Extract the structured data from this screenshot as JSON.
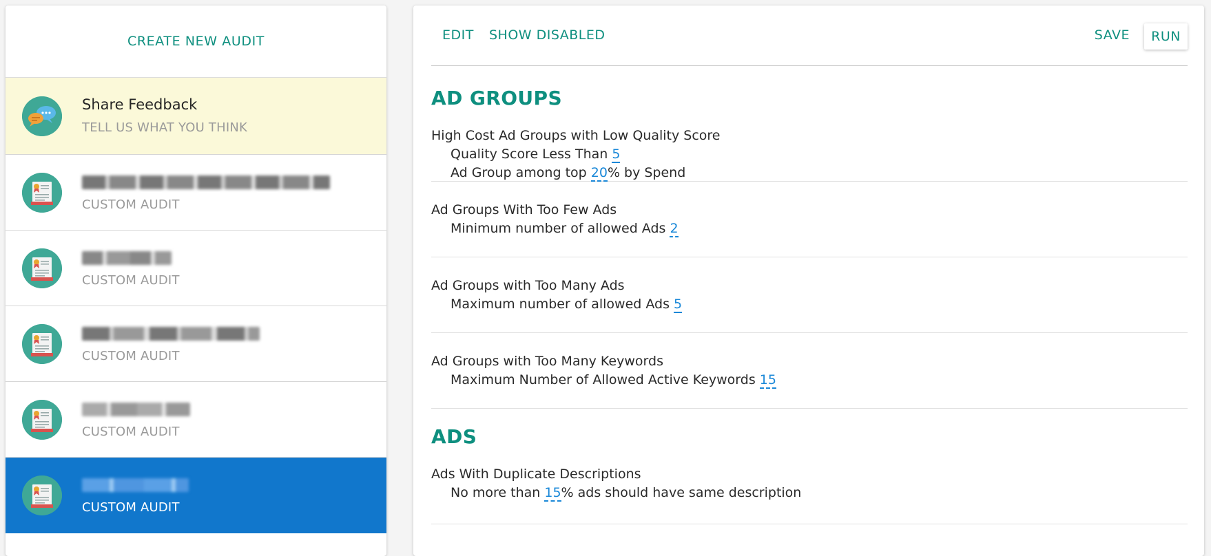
{
  "sidebar": {
    "create_label": "CREATE NEW AUDIT",
    "feedback": {
      "title": "Share Feedback",
      "subtitle": "TELL US WHAT YOU THINK"
    },
    "audits": [
      {
        "subtitle": "CUSTOM AUDIT",
        "selected": false
      },
      {
        "subtitle": "CUSTOM AUDIT",
        "selected": false
      },
      {
        "subtitle": "CUSTOM AUDIT",
        "selected": false
      },
      {
        "subtitle": "CUSTOM AUDIT",
        "selected": false
      },
      {
        "subtitle": "CUSTOM AUDIT",
        "selected": true
      }
    ]
  },
  "toolbar": {
    "edit_label": "EDIT",
    "show_disabled_label": "SHOW DISABLED",
    "save_label": "SAVE",
    "run_label": "RUN"
  },
  "sections": [
    {
      "title": "AD GROUPS",
      "rules": [
        {
          "name": "High Cost Ad Groups with Low Quality Score",
          "params": [
            {
              "before": "Quality Score Less Than ",
              "value": "5",
              "after": ""
            },
            {
              "before": "Ad Group among top ",
              "value": "20",
              "after": "% by Spend"
            }
          ]
        },
        {
          "name": "Ad Groups With Too Few Ads",
          "params": [
            {
              "before": "Minimum number of allowed Ads ",
              "value": "2",
              "after": ""
            }
          ]
        },
        {
          "name": "Ad Groups with Too Many Ads",
          "params": [
            {
              "before": "Maximum number of allowed Ads ",
              "value": "5",
              "after": ""
            }
          ]
        },
        {
          "name": "Ad Groups with Too Many Keywords",
          "params": [
            {
              "before": "Maximum Number of Allowed Active Keywords ",
              "value": "15",
              "after": ""
            }
          ]
        }
      ]
    },
    {
      "title": "ADS",
      "rules": [
        {
          "name": "Ads With Duplicate Descriptions",
          "params": [
            {
              "before": "No more than ",
              "value": "15",
              "after": "% ads should have same description"
            }
          ]
        }
      ]
    }
  ],
  "colors": {
    "accent": "#0e8f7f",
    "value_link": "#1a88d8",
    "selected_bg": "#1177cc",
    "feedback_bg": "#fbf9d9"
  },
  "icons": {
    "feedback": "speech-bubbles-icon",
    "audit": "certificate-icon"
  }
}
